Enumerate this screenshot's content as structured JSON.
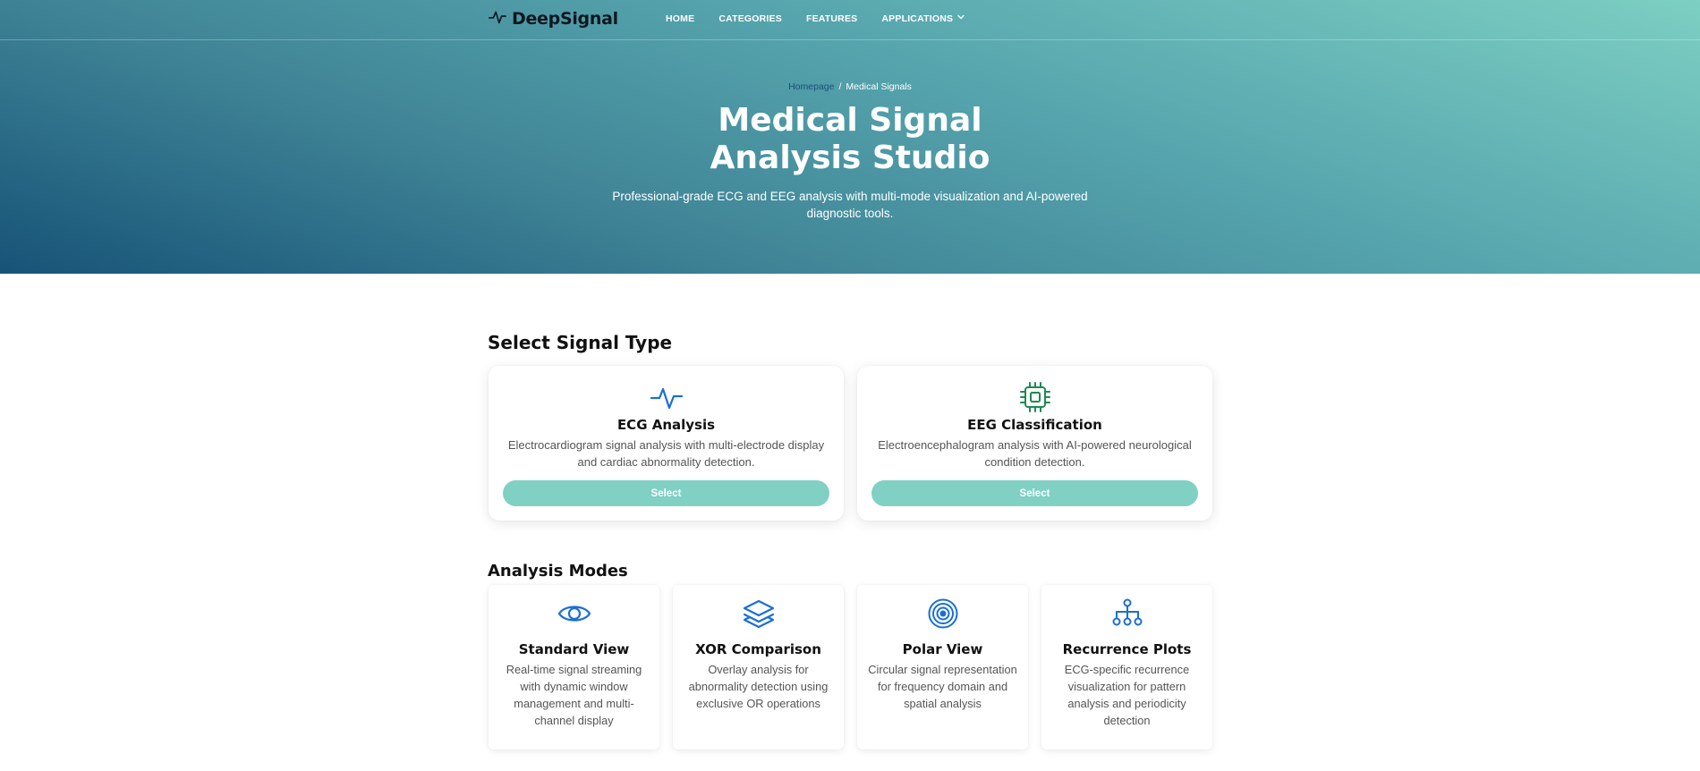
{
  "brand": {
    "name": "DeepSignal",
    "logo_icon": "pulse-icon"
  },
  "nav": [
    {
      "label": "HOME"
    },
    {
      "label": "CATEGORIES"
    },
    {
      "label": "FEATURES"
    },
    {
      "label": "APPLICATIONS",
      "icon": "chevron-down-icon"
    }
  ],
  "breadcrumb": {
    "home": "Homepage",
    "separator": "/",
    "current": "Medical Signals"
  },
  "hero": {
    "title_line1": "Medical Signal",
    "title_line2": "Analysis Studio",
    "subtitle": "Professional-grade ECG and EEG analysis with multi-mode visualization and AI-powered diagnostic tools."
  },
  "signal_section": {
    "title": "Select Signal Type",
    "cards": [
      {
        "icon": "heartbeat-icon",
        "title": "ECG Analysis",
        "description": "Electrocardiogram signal analysis with multi-electrode display and cardiac abnormality detection.",
        "button": "Select"
      },
      {
        "icon": "cpu-chip-icon",
        "title": "EEG Classification",
        "description": "Electroencephalogram analysis with AI-powered neurological condition detection.",
        "button": "Select"
      }
    ]
  },
  "modes_section": {
    "title": "Analysis Modes",
    "cards": [
      {
        "icon": "eye-icon",
        "title": "Standard View",
        "description": "Real-time signal streaming with dynamic window management and multi-channel display"
      },
      {
        "icon": "layers-icon",
        "title": "XOR Comparison",
        "description": "Overlay analysis for abnormality detection using exclusive OR operations"
      },
      {
        "icon": "target-icon",
        "title": "Polar View",
        "description": "Circular signal representation for frequency domain and spatial analysis"
      },
      {
        "icon": "hierarchy-icon",
        "title": "Recurrence Plots",
        "description": "ECG-specific recurrence visualization for pattern analysis and periodicity detection"
      }
    ]
  },
  "colors": {
    "accent": "#80d0c4",
    "icon_blue": "#1a6fd6",
    "icon_green": "#1f8a52",
    "hero_gradient_start": "#7ccfc2",
    "hero_gradient_end": "#175377"
  }
}
